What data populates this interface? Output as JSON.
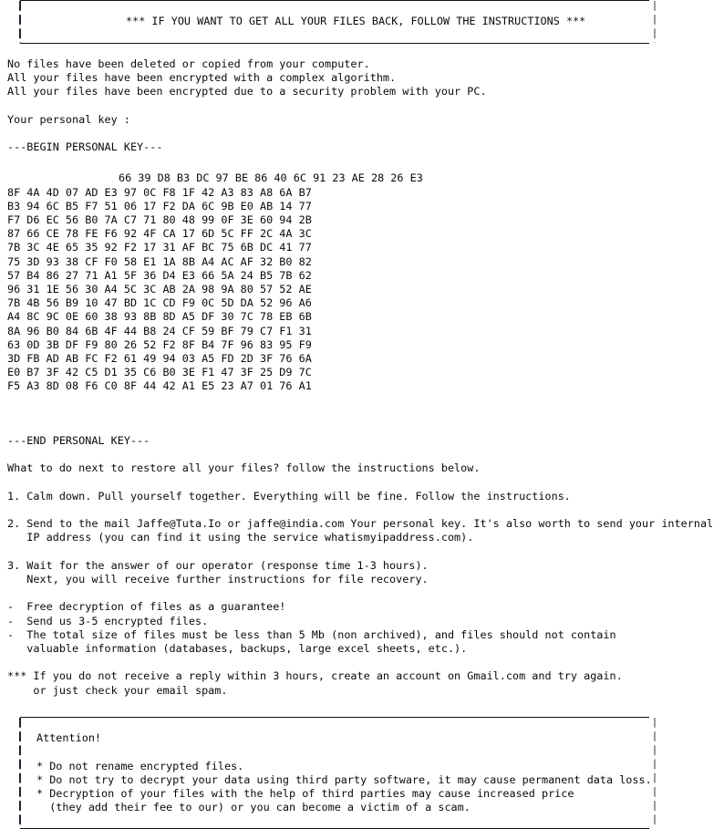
{
  "header_banner": {
    "text": "*** IF YOU WANT TO GET ALL YOUR FILES BACK, FOLLOW THE INSTRUCTIONS ***"
  },
  "intro": {
    "line1": "No files have been deleted or copied from your computer.",
    "line2": "All your files have been encrypted with a complex algorithm.",
    "line3": "All your files have been encrypted due to a security problem with your PC."
  },
  "key_section": {
    "label": "Your personal key :",
    "begin_marker": "---BEGIN PERSONAL KEY---",
    "end_marker": "---END PERSONAL KEY---",
    "rows": [
      "66 39 D8 B3 DC 97 BE 86 40 6C 91 23 AE 28 26 E3",
      "8F 4A 4D 07 AD E3 97 0C F8 1F 42 A3 83 A8 6A B7",
      "B3 94 6C B5 F7 51 06 17 F2 DA 6C 9B E0 AB 14 77",
      "F7 D6 EC 56 B0 7A C7 71 80 48 99 0F 3E 60 94 2B",
      "87 66 CE 78 FE F6 92 4F CA 17 6D 5C FF 2C 4A 3C",
      "7B 3C 4E 65 35 92 F2 17 31 AF BC 75 6B DC 41 77",
      "75 3D 93 38 CF F0 58 E1 1A 8B A4 AC AF 32 B0 82",
      "57 B4 86 27 71 A1 5F 36 D4 E3 66 5A 24 B5 7B 62",
      "96 31 1E 56 30 A4 5C 3C AB 2A 98 9A 80 57 52 AE",
      "7B 4B 56 B9 10 47 BD 1C CD F9 0C 5D DA 52 96 A6",
      "A4 8C 9C 0E 60 38 93 8B 8D A5 DF 30 7C 78 EB 6B",
      "8A 96 B0 84 6B 4F 44 B8 24 CF 59 BF 79 C7 F1 31",
      "63 0D 3B DF F9 80 26 52 F2 8F B4 7F 96 83 95 F9",
      "3D FB AD AB FC F2 61 49 94 03 A5 FD 2D 3F 76 6A",
      "E0 B7 3F 42 C5 D1 35 C6 B0 3E F1 47 3F 25 D9 7C",
      "F5 A3 8D 08 F6 C0 8F 44 42 A1 E5 23 A7 01 76 A1"
    ]
  },
  "instructions": {
    "lead": "What to do next to restore all your files? follow the instructions below.",
    "step1": "1. Calm down. Pull yourself together. Everything will be fine. Follow the instructions.",
    "step2_line1": "2. Send to the mail Jaffe@Tuta.Io or jaffe@india.com Your personal key. It's also worth to send your internal",
    "step2_line2": "   IP address (you can find it using the service whatismyipaddress.com).",
    "step3_line1": "3. Wait for the answer of our operator (response time 1-3 hours).",
    "step3_line2": "   Next, you will receive further instructions for file recovery."
  },
  "guarantees": {
    "bullet1": "-  Free decryption of files as a guarantee!",
    "bullet2": "-  Send us 3-5 encrypted files.",
    "bullet3_line1": "-  The total size of files must be less than 5 Mb (non archived), and files should not contain",
    "bullet3_line2": "   valuable information (databases, backups, large excel sheets, etc.)."
  },
  "notice": {
    "line1": "*** If you do not receive a reply within 3 hours, create an account on Gmail.com and try again.",
    "line2": "    or just check your email spam."
  },
  "attention_box": {
    "title": "Attention!",
    "warning1": "* Do not rename encrypted files.",
    "warning2": "* Do not try to decrypt your data using third party software, it may cause permanent data loss.",
    "warning3_line1": "* Decryption of your files with the help of third parties may cause increased price",
    "warning3_line2": "  (they add their fee to our) or you can become a victim of a scam."
  },
  "emails": {
    "primary": "Jaffe@Tuta.Io",
    "secondary": "jaffe@india.com"
  },
  "colors": {
    "background": "#ffffff",
    "text": "#0a0a0a",
    "rule": "#121212",
    "pipe_left": "#2b1a35",
    "pipe_right": "#9a9a9a"
  }
}
